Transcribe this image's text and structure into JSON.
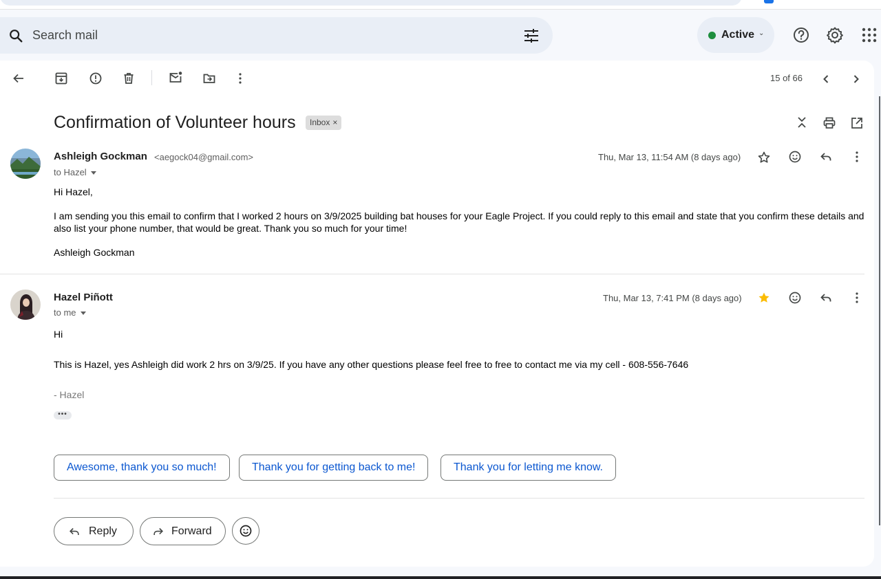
{
  "search": {
    "placeholder": "Search mail"
  },
  "status": {
    "label": "Active",
    "color": "#1e8e3e"
  },
  "header_icons": [
    "help-icon",
    "settings-icon",
    "apps-icon"
  ],
  "toolbar": {
    "icons": [
      "back-arrow-icon",
      "archive-icon",
      "report-spam-icon",
      "delete-icon",
      "mark-unread-icon",
      "move-to-icon",
      "more-icon"
    ],
    "pager": "15 of 66"
  },
  "thread": {
    "subject": "Confirmation of Volunteer hours",
    "label": "Inbox",
    "label_close": "×"
  },
  "messages": [
    {
      "sender": "Ashleigh Gockman",
      "email": "<aegock04@gmail.com>",
      "to": "to Hazel",
      "date": "Thu, Mar 13, 11:54 AM (8 days ago)",
      "starred": false,
      "greeting": "Hi Hazel,",
      "body": "I am sending you this email to confirm that I worked 2 hours on 3/9/2025 building bat houses for your Eagle Project. If you could reply to this email and state that you confirm these details and also list your phone number, that would be great. Thank you so much for your time!",
      "signoff": "Ashleigh Gockman"
    },
    {
      "sender": "Hazel Piñott",
      "to": "to me",
      "date": "Thu, Mar 13, 7:41 PM (8 days ago)",
      "starred": true,
      "greeting": "Hi",
      "body": "This is Hazel, yes Ashleigh did work 2 hrs on 3/9/25.  If you have any other questions please feel free to free to contact me via my cell - 608-556-7646",
      "signoff": "- Hazel",
      "trimmed": "•••"
    }
  ],
  "smart_replies": [
    "Awesome, thank you so much!",
    "Thank you for getting back to me!",
    "Thank you for letting me know."
  ],
  "actions": {
    "reply": "Reply",
    "forward": "Forward"
  },
  "colors": {
    "accent": "#0b57d0",
    "star": "#fbbc04"
  }
}
